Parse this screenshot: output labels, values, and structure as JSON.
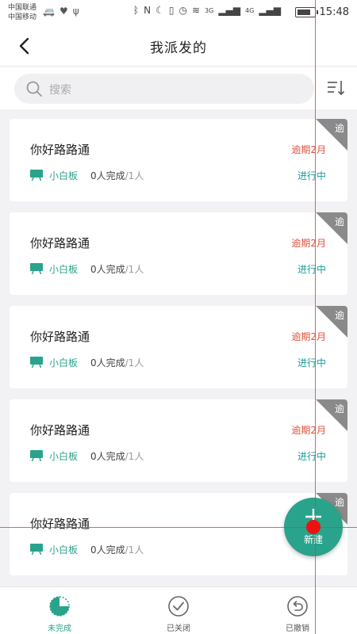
{
  "status_bar": {
    "carrier1": "中国联通",
    "carrier2": "中国移动",
    "net1": "3G",
    "net2": "4G",
    "time": "15:48"
  },
  "nav": {
    "title": "我派发的"
  },
  "search": {
    "placeholder": "搜索"
  },
  "tasks": [
    {
      "title": "你好路路通",
      "overdue": "逾期2月",
      "corner": "逾",
      "board": "小白板",
      "done": "0人完成",
      "total": "/1人",
      "status": "进行中"
    },
    {
      "title": "你好路路通",
      "overdue": "逾期2月",
      "corner": "逾",
      "board": "小白板",
      "done": "0人完成",
      "total": "/1人",
      "status": "进行中"
    },
    {
      "title": "你好路路通",
      "overdue": "逾期2月",
      "corner": "逾",
      "board": "小白板",
      "done": "0人完成",
      "total": "/1人",
      "status": "进行中"
    },
    {
      "title": "你好路路通",
      "overdue": "逾期2月",
      "corner": "逾",
      "board": "小白板",
      "done": "0人完成",
      "total": "/1人",
      "status": "进行中"
    },
    {
      "title": "你好路路通",
      "overdue": "",
      "corner": "逾",
      "board": "小白板",
      "done": "0人完成",
      "total": "/1人",
      "status": ""
    }
  ],
  "fab": {
    "label": "新建"
  },
  "tabs": [
    {
      "label": "未完成",
      "icon": "pie-icon",
      "active": true
    },
    {
      "label": "已关闭",
      "icon": "check-circle-icon",
      "active": false
    },
    {
      "label": "已撤销",
      "icon": "undo-circle-icon",
      "active": false
    }
  ],
  "colors": {
    "accent": "#2aa38c",
    "overdue": "#e0523c",
    "status": "#1e9c9c",
    "corner": "#8a8a8a"
  }
}
